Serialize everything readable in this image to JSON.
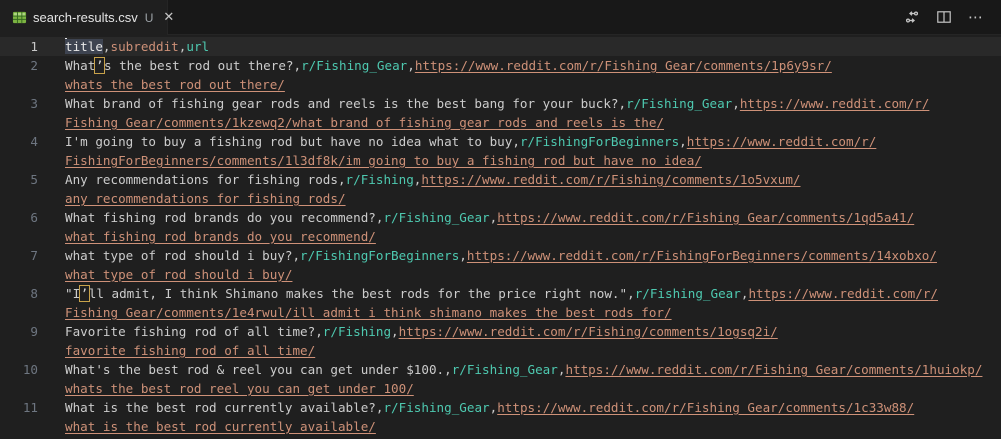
{
  "tab_bar": {
    "active_tab": {
      "label": "search-results.csv",
      "git_status": "U",
      "close_glyph": "✕",
      "file_icon": "csv-table-icon"
    },
    "actions": [
      {
        "name": "open-changes"
      },
      {
        "name": "split-editor"
      },
      {
        "name": "more-actions",
        "glyph": "⋯"
      }
    ]
  },
  "colors": {
    "editor_background": "#1f1f1f",
    "tabbar_background": "#181818",
    "subreddit_field": "#4ec9b0",
    "url_field": "#ce9178",
    "plain_text": "#cccccc",
    "line_number": "#6e7681",
    "active_line_background": "#292929",
    "unicode_highlight_border": "#c8a24a",
    "csv_icon_green": "#7cb342"
  },
  "editor": {
    "language": "csv",
    "lines": [
      {
        "number": "1",
        "active": true,
        "rows": [
          [
            {
              "t": "title",
              "c": "sel"
            },
            {
              "t": ",",
              "c": "p"
            },
            {
              "t": "subreddit",
              "c": "hdr2"
            },
            {
              "t": ",",
              "c": "p"
            },
            {
              "t": "url",
              "c": "hdr3"
            }
          ]
        ]
      },
      {
        "number": "2",
        "rows": [
          [
            {
              "t": "What",
              "c": "p"
            },
            {
              "t": "’",
              "c": "box"
            },
            {
              "t": "s the best rod out there?,",
              "c": "p"
            },
            {
              "t": "r/Fishing_Gear",
              "c": "s"
            },
            {
              "t": ",",
              "c": "p"
            },
            {
              "t": "https://www.reddit.com/r/Fishing_Gear/comments/1p6y9sr/",
              "c": "u"
            }
          ],
          [
            {
              "t": "whats_the_best_rod_out_there/",
              "c": "u"
            }
          ]
        ]
      },
      {
        "number": "3",
        "rows": [
          [
            {
              "t": "What brand of fishing gear rods and reels is the best bang for your buck?,",
              "c": "p"
            },
            {
              "t": "r/Fishing_Gear",
              "c": "s"
            },
            {
              "t": ",",
              "c": "p"
            },
            {
              "t": "https://www.reddit.com/r/",
              "c": "u"
            }
          ],
          [
            {
              "t": "Fishing_Gear/comments/1kzewq2/what_brand_of_fishing_gear_rods_and_reels_is_the/",
              "c": "u"
            }
          ]
        ]
      },
      {
        "number": "4",
        "rows": [
          [
            {
              "t": "I'm going to buy a fishing rod but have no idea what to buy,",
              "c": "p"
            },
            {
              "t": "r/FishingForBeginners",
              "c": "s"
            },
            {
              "t": ",",
              "c": "p"
            },
            {
              "t": "https://www.reddit.com/r/",
              "c": "u"
            }
          ],
          [
            {
              "t": "FishingForBeginners/comments/1l3df8k/im_going_to_buy_a_fishing_rod_but_have_no_idea/",
              "c": "u"
            }
          ]
        ]
      },
      {
        "number": "5",
        "rows": [
          [
            {
              "t": "Any recommendations for fishing rods,",
              "c": "p"
            },
            {
              "t": "r/Fishing",
              "c": "s"
            },
            {
              "t": ",",
              "c": "p"
            },
            {
              "t": "https://www.reddit.com/r/Fishing/comments/1o5vxum/",
              "c": "u"
            }
          ],
          [
            {
              "t": "any_recommendations_for_fishing_rods/",
              "c": "u"
            }
          ]
        ]
      },
      {
        "number": "6",
        "rows": [
          [
            {
              "t": "What fishing rod brands do you recommend?,",
              "c": "p"
            },
            {
              "t": "r/Fishing_Gear",
              "c": "s"
            },
            {
              "t": ",",
              "c": "p"
            },
            {
              "t": "https://www.reddit.com/r/Fishing_Gear/comments/1qd5a41/",
              "c": "u"
            }
          ],
          [
            {
              "t": "what_fishing_rod_brands_do_you_recommend/",
              "c": "u"
            }
          ]
        ]
      },
      {
        "number": "7",
        "rows": [
          [
            {
              "t": "what type of rod should i buy?,",
              "c": "p"
            },
            {
              "t": "r/FishingForBeginners",
              "c": "s"
            },
            {
              "t": ",",
              "c": "p"
            },
            {
              "t": "https://www.reddit.com/r/FishingForBeginners/comments/14xobxo/",
              "c": "u"
            }
          ],
          [
            {
              "t": "what_type_of_rod_should_i_buy/",
              "c": "u"
            }
          ]
        ]
      },
      {
        "number": "8",
        "rows": [
          [
            {
              "t": "\"I",
              "c": "p"
            },
            {
              "t": "’",
              "c": "box"
            },
            {
              "t": "ll admit, I think Shimano makes the best rods for the price right now.\",",
              "c": "p"
            },
            {
              "t": "r/Fishing_Gear",
              "c": "s"
            },
            {
              "t": ",",
              "c": "p"
            },
            {
              "t": "https://www.reddit.com/r/",
              "c": "u"
            }
          ],
          [
            {
              "t": "Fishing_Gear/comments/1e4rwul/ill_admit_i_think_shimano_makes_the_best_rods_for/",
              "c": "u"
            }
          ]
        ]
      },
      {
        "number": "9",
        "rows": [
          [
            {
              "t": "Favorite fishing rod of all time?,",
              "c": "p"
            },
            {
              "t": "r/Fishing",
              "c": "s"
            },
            {
              "t": ",",
              "c": "p"
            },
            {
              "t": "https://www.reddit.com/r/Fishing/comments/1ogsq2i/",
              "c": "u"
            }
          ],
          [
            {
              "t": "favorite_fishing_rod_of_all_time/",
              "c": "u"
            }
          ]
        ]
      },
      {
        "number": "10",
        "rows": [
          [
            {
              "t": "What's the best rod & reel you can get under $100.,",
              "c": "p"
            },
            {
              "t": "r/Fishing_Gear",
              "c": "s"
            },
            {
              "t": ",",
              "c": "p"
            },
            {
              "t": "https://www.reddit.com/r/Fishing_Gear/comments/1huiokp/",
              "c": "u"
            }
          ],
          [
            {
              "t": "whats_the_best_rod_reel_you_can_get_under_100/",
              "c": "u"
            }
          ]
        ]
      },
      {
        "number": "11",
        "rows": [
          [
            {
              "t": "What is the best rod currently available?,",
              "c": "p"
            },
            {
              "t": "r/Fishing_Gear",
              "c": "s"
            },
            {
              "t": ",",
              "c": "p"
            },
            {
              "t": "https://www.reddit.com/r/Fishing_Gear/comments/1c33w88/",
              "c": "u"
            }
          ],
          [
            {
              "t": "what_is_the_best_rod_currently_available/",
              "c": "u"
            }
          ]
        ]
      }
    ]
  }
}
